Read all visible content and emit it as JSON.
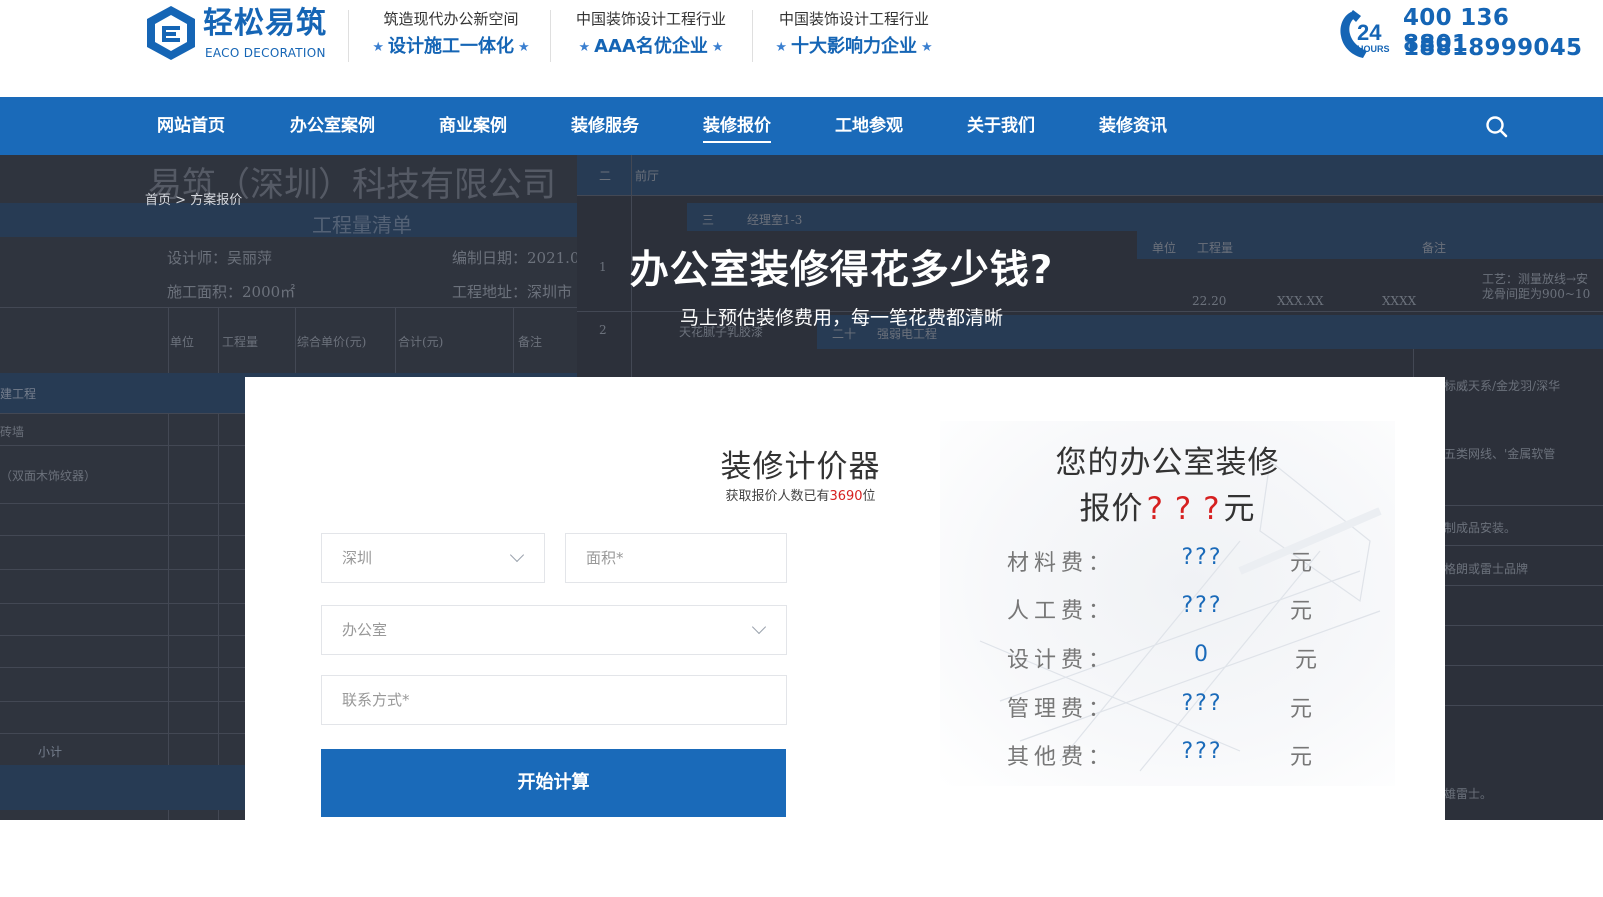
{
  "brand": {
    "logo_cn": "轻松易筑",
    "logo_en": "EACO DECORATION"
  },
  "slogans": [
    {
      "line1": "筑造现代办公新空间",
      "line2": "设计施工一体化"
    },
    {
      "line1": "中国装饰设计工程行业",
      "line2": "AAA名优企业"
    },
    {
      "line1": "中国装饰设计工程行业",
      "line2": "十大影响力企业"
    }
  ],
  "hotline": {
    "icon_number": "24",
    "icon_label": "HOURS",
    "phone1": "400 136 8801",
    "phone2": "18818999045"
  },
  "nav": {
    "items": [
      {
        "label": "网站首页"
      },
      {
        "label": "办公室案例"
      },
      {
        "label": "商业案例"
      },
      {
        "label": "装修服务"
      },
      {
        "label": "装修报价",
        "active": true
      },
      {
        "label": "工地参观"
      },
      {
        "label": "关于我们"
      },
      {
        "label": "装修资讯"
      }
    ],
    "search_icon": "search-icon"
  },
  "banner": {
    "breadcrumb_home": "首页",
    "breadcrumb_sep": ">",
    "breadcrumb_current": "方案报价",
    "title": "办公室装修得花多少钱?",
    "subtitle": "马上预估装修费用，每一笔花费都清晰",
    "bg": {
      "company": "易筑（深圳）科技有限公司",
      "list_title": "工程量清单",
      "designer": "设计师：吴丽萍",
      "date": "编制日期：2021.0",
      "area": "施工面积：2000㎡",
      "address": "工程地址：深圳市",
      "col_unit": "单位",
      "col_qty": "工程量",
      "col_price": "综合单价(元)",
      "col_total": "合计(元)",
      "col_note": "备注",
      "row_a": "建工程",
      "row_b": "砖墙",
      "row_c": "（双面木饰纹器）",
      "subtotal": "小计",
      "r_hall": "前厅",
      "r_room": "经理室1-3",
      "r_ceiling": "天花腻子乳胶漆",
      "r_elec": "强弱电工程",
      "r_qty": "22.20",
      "r_xx": "XXX.XX",
      "r_xxxx": "XXXX",
      "r_note1": "工艺：测量放线→安",
      "r_note2": "龙骨间距为900~10",
      "r_note3": "国标威天系/金龙羽/深华",
      "r_note4": "超五类网线、'金属软管",
      "r_note5": "定制成品安装。",
      "r_note6": "罗格朗或雷士品牌",
      "r_note7": "三雄雷士。",
      "r_num1": "1",
      "r_num2": "2",
      "r_num3": "二",
      "r_num4": "三",
      "r_num5": "二十"
    }
  },
  "calculator": {
    "title": "装修计价器",
    "count_prefix": "获取报价人数已有",
    "count_value": "3690",
    "count_suffix": "位",
    "city_value": "深圳",
    "area_placeholder": "面积*",
    "type_value": "办公室",
    "contact_placeholder": "联系方式*",
    "submit_label": "开始计算"
  },
  "result": {
    "title_line1": "您的办公室装修",
    "title_prefix": "报价",
    "title_q": "? ? ?",
    "title_suffix": "元",
    "rows": [
      {
        "label": "材料费：",
        "value": "???",
        "unit": "元"
      },
      {
        "label": "人工费：",
        "value": "???",
        "unit": "元"
      },
      {
        "label": "设计费：",
        "value": "0",
        "unit": "元"
      },
      {
        "label": "管理费：",
        "value": "???",
        "unit": "元"
      },
      {
        "label": "其他费：",
        "value": "???",
        "unit": "元"
      }
    ]
  },
  "colors": {
    "brand_blue": "#1a6ab9",
    "accent_red": "#d62020"
  }
}
